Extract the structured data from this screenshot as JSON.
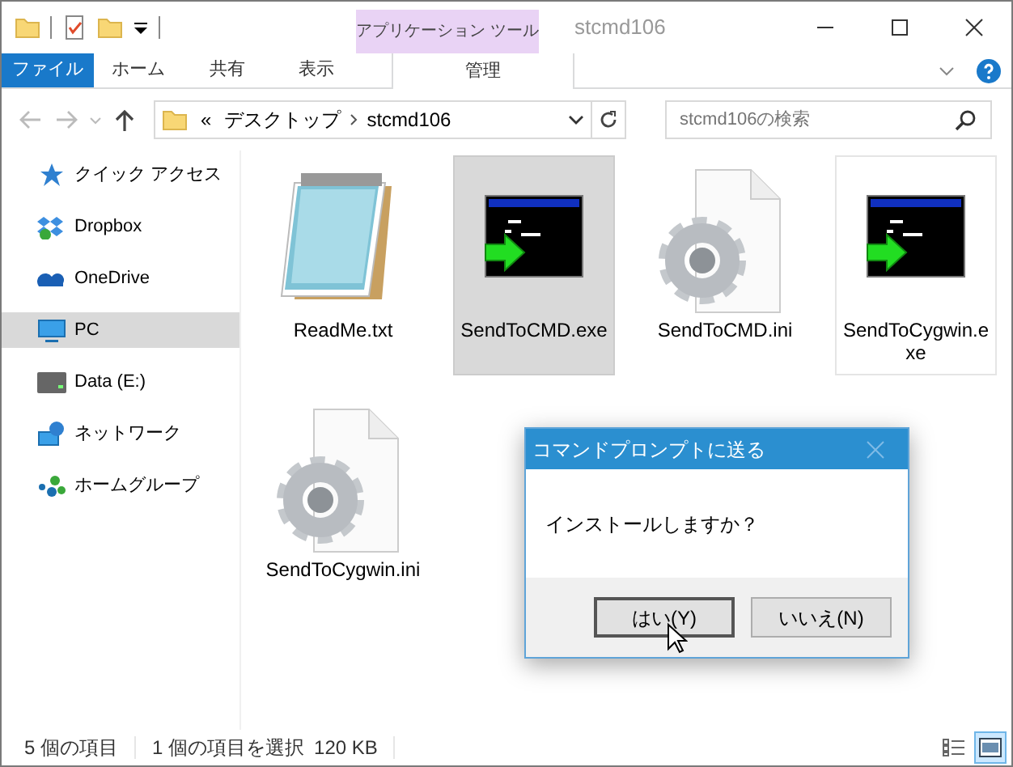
{
  "window": {
    "title": "stcmd106",
    "context_group": "アプリケーション ツール"
  },
  "ribbon_tabs": [
    {
      "label": "ファイル",
      "kind": "file"
    },
    {
      "label": "ホーム",
      "kind": "normal"
    },
    {
      "label": "共有",
      "kind": "normal"
    },
    {
      "label": "表示",
      "kind": "normal"
    },
    {
      "label": "管理",
      "kind": "context"
    }
  ],
  "address": {
    "crumbs": [
      "«",
      "デスクトップ",
      "stcmd106"
    ]
  },
  "search": {
    "placeholder": "stcmd106の検索"
  },
  "sidebar": {
    "items": [
      {
        "label": "クイック アクセス",
        "kind": "star",
        "selected": false
      },
      {
        "label": "Dropbox",
        "kind": "dropbox",
        "selected": false
      },
      {
        "label": "OneDrive",
        "kind": "cloud",
        "selected": false
      },
      {
        "label": "PC",
        "kind": "pc",
        "selected": true
      },
      {
        "label": "Data (E:)",
        "kind": "drive",
        "selected": false
      },
      {
        "label": "ネットワーク",
        "kind": "network",
        "selected": false
      },
      {
        "label": "ホームグループ",
        "kind": "homegroup",
        "selected": false
      }
    ]
  },
  "files": [
    {
      "name": "ReadMe.txt",
      "kind": "text",
      "selected": false,
      "hot": false
    },
    {
      "name": "SendToCMD.exe",
      "kind": "exe",
      "selected": true,
      "hot": false
    },
    {
      "name": "SendToCMD.ini",
      "kind": "ini",
      "selected": false,
      "hot": false
    },
    {
      "name": "SendToCygwin.exe",
      "kind": "exe",
      "selected": false,
      "hot": true
    },
    {
      "name": "SendToCygwin.ini",
      "kind": "ini",
      "selected": false,
      "hot": false
    }
  ],
  "dialog": {
    "title": "コマンドプロンプトに送る",
    "message": "インストールしますか？",
    "buttons": [
      {
        "label": "はい(Y)",
        "default": true
      },
      {
        "label": "いいえ(N)",
        "default": false
      }
    ]
  },
  "status_bar": {
    "item_count": "5 個の項目",
    "selection": "1 個の項目を選択",
    "size": "120 KB"
  },
  "view_buttons": [
    {
      "kind": "details",
      "selected": false
    },
    {
      "kind": "large-icons",
      "selected": true
    }
  ]
}
